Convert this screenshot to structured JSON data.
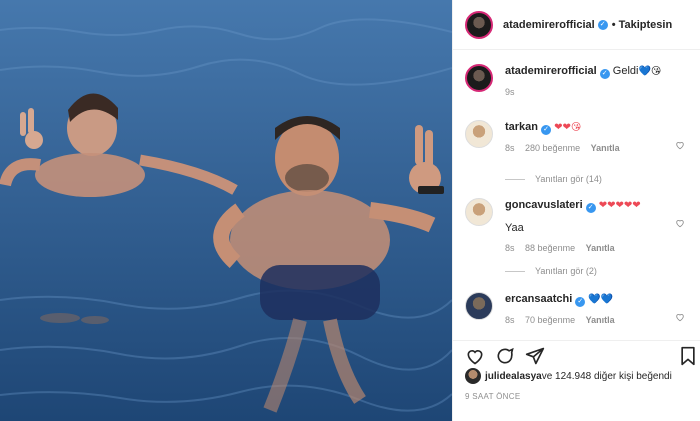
{
  "post": {
    "username": "atademirerofficial",
    "follow_label": "• Takiptesin",
    "caption_text": "Geldi",
    "caption_emoji": "💙😘",
    "caption_time": "9s",
    "likes_user": "julidealasya",
    "likes_rest": " ve 124.948 diğer kişi beğendi",
    "time_ago": "9 SAAT ÖNCE"
  },
  "comments": [
    {
      "user": "tarkan",
      "emoji": "❤❤😘",
      "text": "",
      "time": "8s",
      "likes": "280 beğenme",
      "reply": "Yanıtla",
      "replies": "Yanıtları gör (14)"
    },
    {
      "user": "goncavuslateri",
      "emoji": "❤❤❤❤❤",
      "text": "Yaa",
      "time": "8s",
      "likes": "88 beğenme",
      "reply": "Yanıtla",
      "replies": "Yanıtları gör (2)"
    },
    {
      "user": "ercansaatchi",
      "emoji": "💙💙",
      "text": "",
      "time": "8s",
      "likes": "70 beğenme",
      "reply": "Yanıtla",
      "replies": ""
    }
  ],
  "icons": {
    "heart": "heart-icon",
    "comment": "comment-icon",
    "share": "share-icon",
    "save": "bookmark-icon"
  },
  "colors": {
    "verified": "#3897f0",
    "heart": "#ed4956",
    "water": "#2a5a8e"
  }
}
